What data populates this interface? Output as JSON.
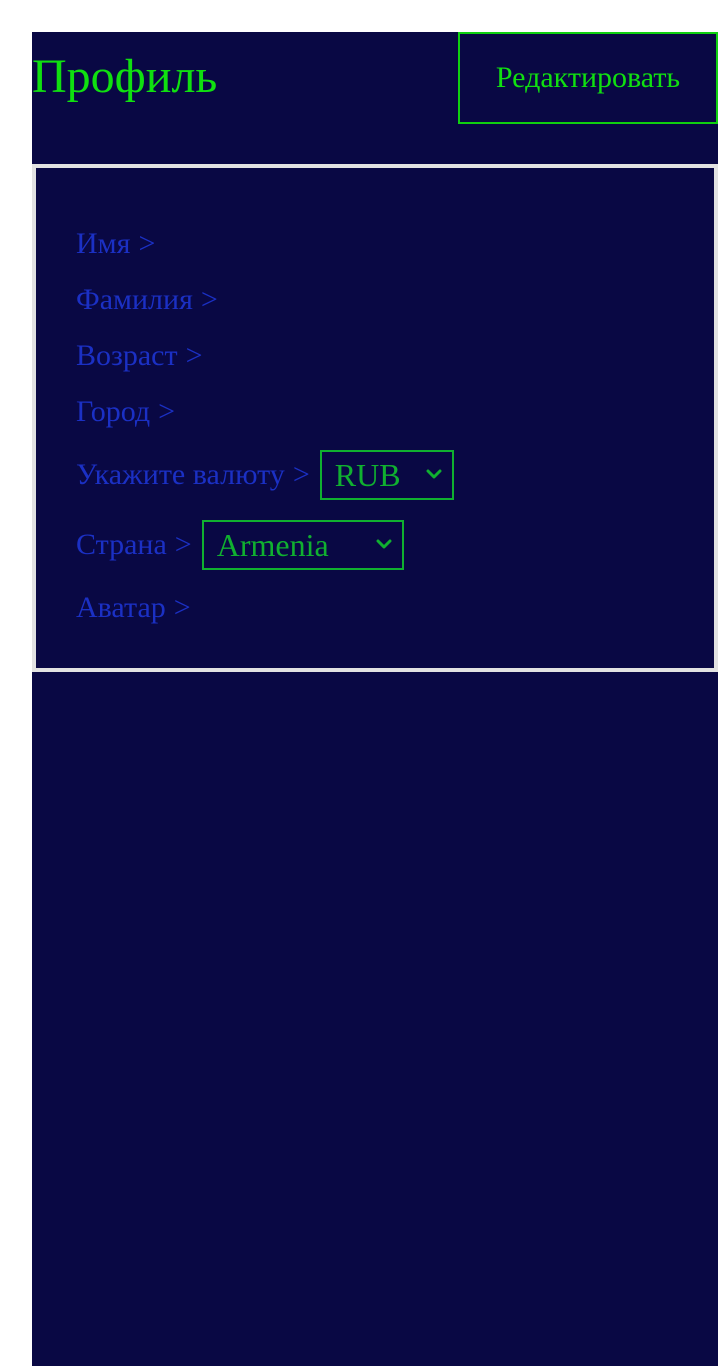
{
  "header": {
    "title": "Профиль",
    "edit_label": "Редактировать"
  },
  "profile": {
    "fields": [
      {
        "label": "Имя",
        "separator": ">"
      },
      {
        "label": "Фамилия",
        "separator": ">"
      },
      {
        "label": "Возраст",
        "separator": ">"
      },
      {
        "label": "Город",
        "separator": ">"
      },
      {
        "label": "Укажите валюту",
        "separator": ">"
      },
      {
        "label": "Страна",
        "separator": ">"
      },
      {
        "label": "Аватар",
        "separator": ">"
      }
    ],
    "currency_select": {
      "value": "RUB",
      "icon": "chevron-down-icon"
    },
    "country_select": {
      "value": "Armenia",
      "icon": "chevron-down-icon"
    }
  },
  "colors": {
    "background": "#090844",
    "accent_green": "#10e010",
    "label_blue": "#1b30c4",
    "select_green": "#10b030",
    "panel_border": "#e2e2e2"
  }
}
